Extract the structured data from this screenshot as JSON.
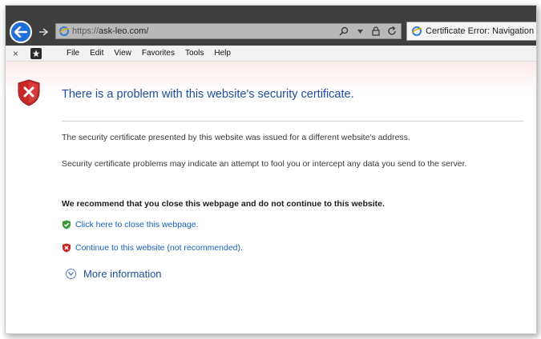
{
  "browser": {
    "url_protocol": "https://",
    "url_host": "ask-leo.com/",
    "tab_title": "Certificate Error: Navigation",
    "menu": [
      "File",
      "Edit",
      "View",
      "Favorites",
      "Tools",
      "Help"
    ],
    "close_glyph": "×"
  },
  "page": {
    "title": "There is a problem with this website's security certificate.",
    "para1": "The security certificate presented by this website was issued for a different website's address.",
    "para2": "Security certificate problems may indicate an attempt to fool you or intercept any data you send to the server.",
    "recommend": "We recommend that you close this webpage and do not continue to this website.",
    "close_link": "Click here to close this webpage.",
    "continue_link": "Continue to this website (not recommended).",
    "more_info": "More information"
  },
  "colors": {
    "accent": "#1f4e9c",
    "link": "#1a5fb4",
    "error": "#c62828",
    "ok": "#3a9a3a"
  },
  "icons": {
    "back": "back-arrow-icon",
    "shield": "shield-error-icon",
    "ok": "green-shield-icon",
    "bad": "red-shield-icon",
    "more": "chevron-down-circle-icon"
  }
}
